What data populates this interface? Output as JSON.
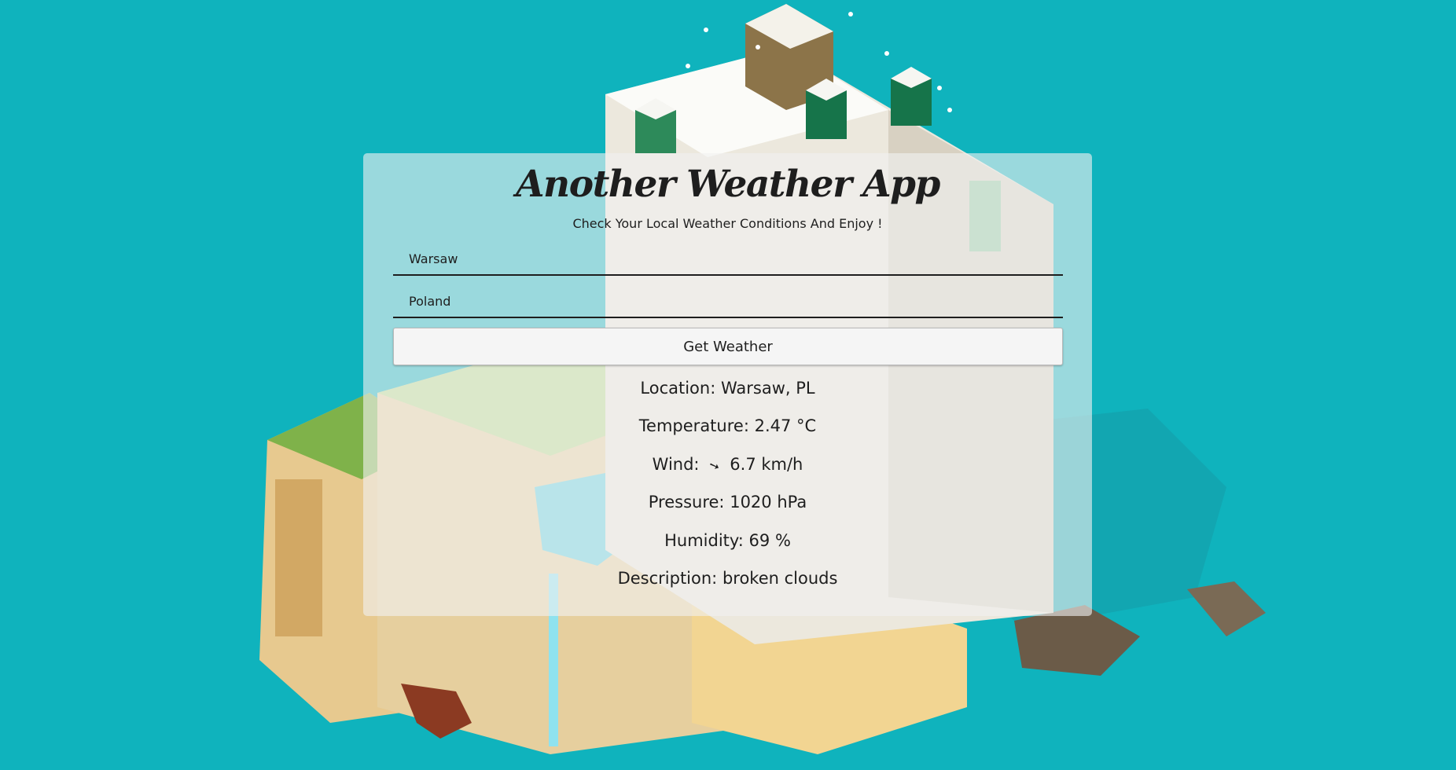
{
  "app": {
    "title": "Another Weather App",
    "subtitle": "Check Your Local Weather Conditions And Enjoy !"
  },
  "form": {
    "city_value": "Warsaw",
    "country_value": "Poland",
    "submit_label": "Get Weather"
  },
  "results": {
    "location_label": "Location:",
    "location_value": "Warsaw, PL",
    "temperature_label": "Temperature:",
    "temperature_value": "2.47 °C",
    "wind_label": "Wind:",
    "wind_arrow": "➘",
    "wind_icon": "wind-direction-arrow-icon",
    "wind_value": "6.7 km/h",
    "pressure_label": "Pressure:",
    "pressure_value": "1020 hPa",
    "humidity_label": "Humidity:",
    "humidity_value": "69 %",
    "description_label": "Description:",
    "description_value": "broken clouds"
  },
  "colors": {
    "background": "#0fb3bd",
    "card": "#f0f0f0",
    "text": "#1e1e1e"
  }
}
